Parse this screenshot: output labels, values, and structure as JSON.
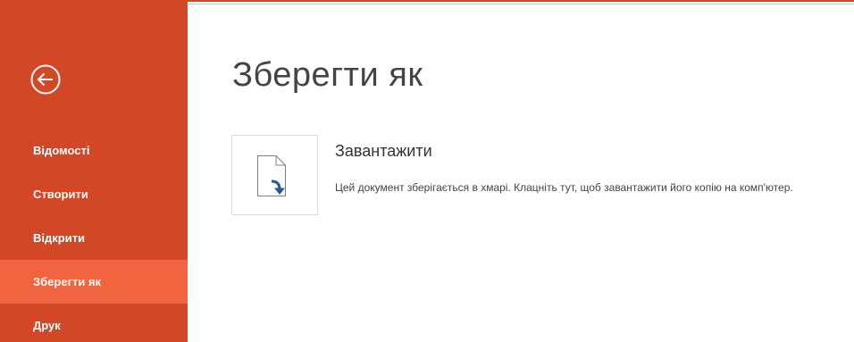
{
  "window": {
    "accent_color": "#d24726",
    "active_item_color": "#f0643f"
  },
  "sidebar": {
    "back_icon": "back-arrow-circle-icon",
    "items": [
      {
        "label": "Відомості",
        "active": false
      },
      {
        "label": "Створити",
        "active": false
      },
      {
        "label": "Відкрити",
        "active": false
      },
      {
        "label": "Зберегти як",
        "active": true
      },
      {
        "label": "Друк",
        "active": false
      }
    ]
  },
  "main": {
    "title": "Зберегти як",
    "upload": {
      "icon": "document-download-icon",
      "title": "Завантажити",
      "description": "Цей документ зберігається в хмарі. Клацніть тут, щоб завантажити його копію на комп'ютер."
    }
  }
}
